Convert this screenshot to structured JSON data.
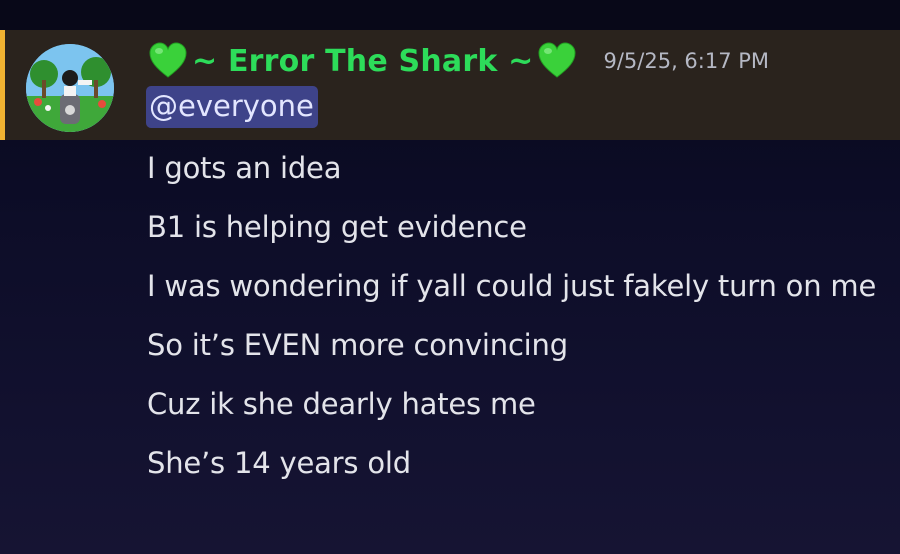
{
  "message": {
    "username": "~ Error The Shark ~",
    "heart_emoji": "green-heart",
    "timestamp": "9/5/25, 6:17 PM",
    "mention": "@everyone",
    "lines": [
      "I gots an idea",
      "B1 is helping get evidence",
      "I was wondering if yall could just fakely turn on me",
      "So it’s EVEN more convincing",
      "Cuz ik she dearly hates me",
      "She’s 14 years old"
    ]
  },
  "colors": {
    "username": "#2ddc5a",
    "mention_bar": "#f0b232",
    "mention_bg": "#3e4389",
    "highlight_bg": "#2a231d",
    "text": "#e3e4ea",
    "timestamp": "#b5b8c4"
  }
}
